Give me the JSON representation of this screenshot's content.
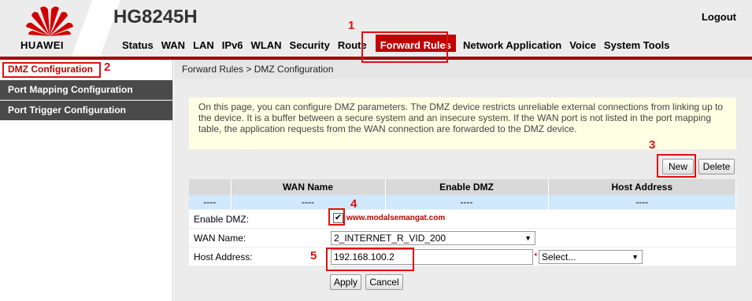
{
  "brand": "HUAWEI",
  "model": "HG8245H",
  "logout": "Logout",
  "nav": [
    {
      "label": "Status"
    },
    {
      "label": "WAN"
    },
    {
      "label": "LAN"
    },
    {
      "label": "IPv6"
    },
    {
      "label": "WLAN"
    },
    {
      "label": "Security"
    },
    {
      "label": "Route"
    },
    {
      "label": "Forward Rules",
      "active": true
    },
    {
      "label": "Network Application"
    },
    {
      "label": "Voice"
    },
    {
      "label": "System Tools"
    }
  ],
  "sidebar": [
    {
      "label": "DMZ Configuration",
      "active": true
    },
    {
      "label": "Port Mapping Configuration"
    },
    {
      "label": "Port Trigger Configuration"
    }
  ],
  "breadcrumb": "Forward Rules > DMZ Configuration",
  "info": "On this page, you can configure DMZ parameters. The DMZ device restricts unreliable external connections from linking up to the device. It is a buffer between a secure system and an insecure system. If the WAN port is not listed in the port mapping table, the application requests from the WAN connection are forwarded to the DMZ device.",
  "buttons": {
    "new": "New",
    "delete": "Delete",
    "apply": "Apply",
    "cancel": "Cancel"
  },
  "table": {
    "headers": [
      "",
      "WAN Name",
      "Enable DMZ",
      "Host Address"
    ],
    "row": [
      "----",
      "----",
      "----",
      "----"
    ]
  },
  "form": {
    "enable_label": "Enable DMZ:",
    "enable_checked": true,
    "check_mark": "✔",
    "watermark": "www.modalsemangat.com",
    "wan_label": "WAN Name:",
    "wan_value": "2_INTERNET_R_VID_200",
    "host_label": "Host Address:",
    "host_value": "192.168.100.2",
    "required_mark": "*",
    "select_value": "Select..."
  },
  "annotations": [
    "1",
    "2",
    "3",
    "4",
    "5"
  ],
  "colors": {
    "accent": "#c00000",
    "annotation": "#e01010",
    "table_row": "#cfe8fb",
    "info_bg": "#ffffe3"
  }
}
